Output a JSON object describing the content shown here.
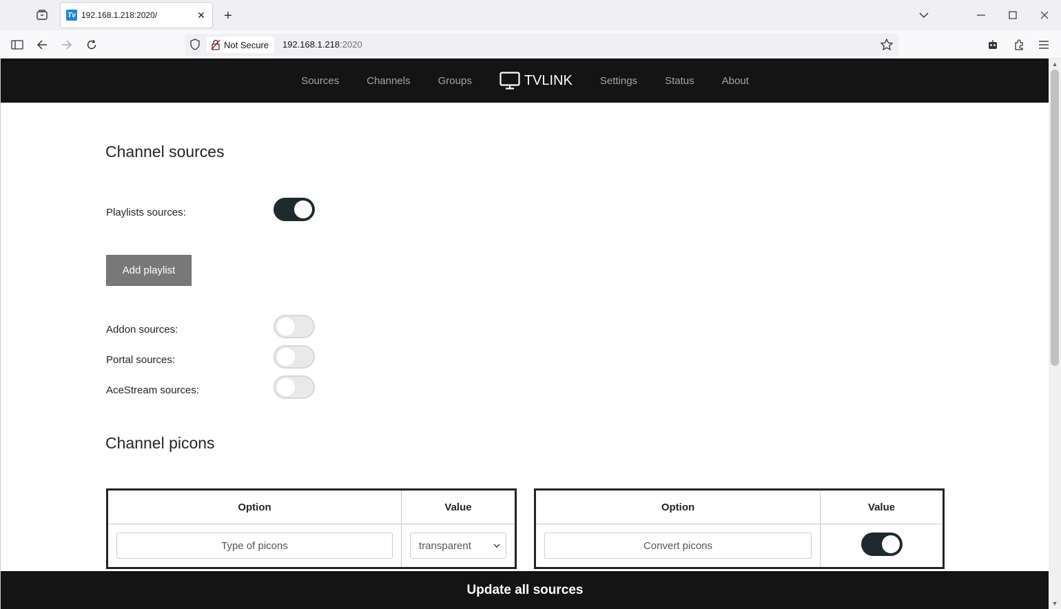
{
  "browser": {
    "tab_title": "192.168.1.218:2020/",
    "favicon_text": "Tv",
    "security_label": "Not Secure",
    "url_host": "192.168.1.218",
    "url_port": ":2020"
  },
  "site_nav": {
    "items_left": [
      "Sources",
      "Channels",
      "Groups"
    ],
    "brand": "TVLINK",
    "items_right": [
      "Settings",
      "Status",
      "About"
    ]
  },
  "channel_sources": {
    "heading": "Channel sources",
    "playlists_label": "Playlists sources:",
    "playlists_enabled": true,
    "add_playlist_label": "Add playlist",
    "addon_label": "Addon sources:",
    "addon_enabled": false,
    "portal_label": "Portal sources:",
    "portal_enabled": false,
    "acestream_label": "AceStream sources:",
    "acestream_enabled": false
  },
  "channel_picons": {
    "heading": "Channel picons",
    "table_left": {
      "col_option": "Option",
      "col_value": "Value",
      "row_option": "Type of picons",
      "row_value": "transparent"
    },
    "table_right": {
      "col_option": "Option",
      "col_value": "Value",
      "row_option": "Convert picons",
      "row_value_enabled": true
    }
  },
  "footer": {
    "update_label": "Update all sources"
  }
}
